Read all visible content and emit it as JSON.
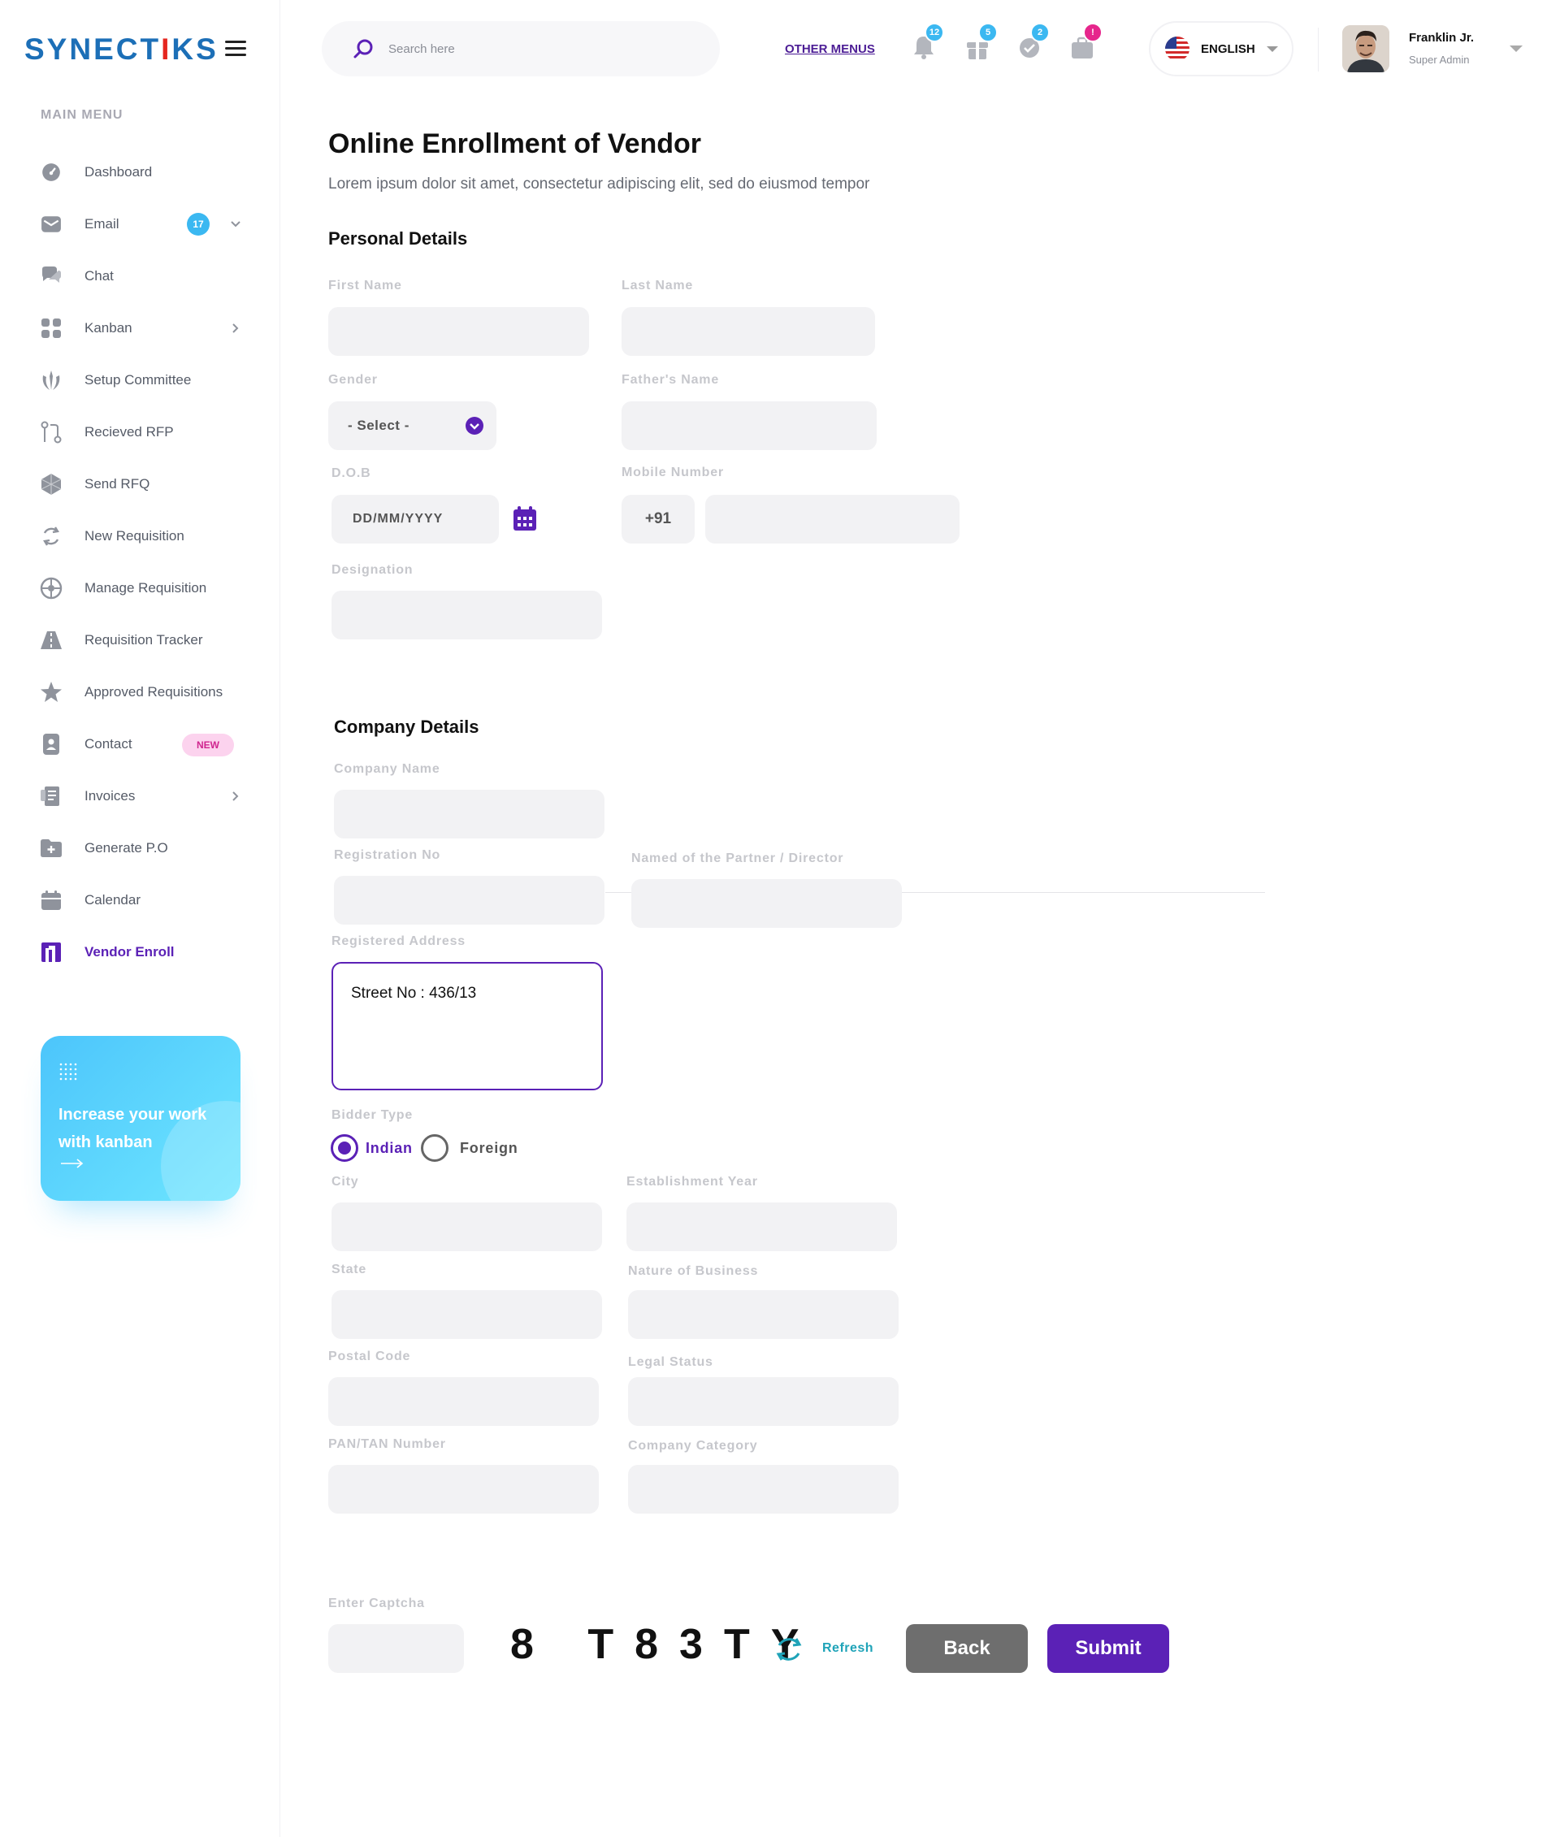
{
  "brand": {
    "logo_pre": "SYNECT",
    "logo_i": "I",
    "logo_post": "KS"
  },
  "sidebar": {
    "heading": "MAIN MENU",
    "items": [
      {
        "label": "Dashboard",
        "icon": "gauge-icon"
      },
      {
        "label": "Email",
        "icon": "mail-icon",
        "badge": "17"
      },
      {
        "label": "Chat",
        "icon": "chat-icon"
      },
      {
        "label": "Kanban",
        "icon": "grid-icon"
      },
      {
        "label": "Setup Committee",
        "icon": "committee-icon"
      },
      {
        "label": "Recieved RFP",
        "icon": "git-compare-icon"
      },
      {
        "label": "Send RFQ",
        "icon": "hexagon-icon"
      },
      {
        "label": "New Requisition",
        "icon": "refresh-icon"
      },
      {
        "label": "Manage Requisition",
        "icon": "aperture-icon"
      },
      {
        "label": "Requisition Tracker",
        "icon": "road-icon"
      },
      {
        "label": "Approved Requisitions",
        "icon": "star-icon"
      },
      {
        "label": "Contact",
        "icon": "contact-icon",
        "tag": "NEW"
      },
      {
        "label": "Invoices",
        "icon": "receipt-icon"
      },
      {
        "label": "Generate P.O",
        "icon": "folder-plus-icon"
      },
      {
        "label": "Calendar",
        "icon": "calendar-icon"
      },
      {
        "label": "Vendor Enroll",
        "icon": "vendor-icon"
      }
    ],
    "promo": {
      "text": "Increase your work with kanban"
    }
  },
  "header": {
    "search_placeholder": "Search here",
    "other_menus": "OTHER MENUS",
    "notifications": [
      {
        "icon": "bell-icon",
        "count": "12",
        "color": "#3bb8f1"
      },
      {
        "icon": "gift-icon",
        "count": "5",
        "color": "#3bb8f1"
      },
      {
        "icon": "chat-check-icon",
        "count": "2",
        "color": "#3bb8f1"
      },
      {
        "icon": "briefcase-icon",
        "count": "!",
        "color": "#e6268c"
      }
    ],
    "language": "ENGLISH",
    "user": {
      "name": "Franklin Jr.",
      "role": "Super Admin"
    }
  },
  "page": {
    "title": "Online Enrollment of Vendor",
    "subtitle": "Lorem ipsum dolor sit amet, consectetur adipiscing elit, sed do eiusmod tempor"
  },
  "personal": {
    "title": "Personal Details",
    "first_name": "First Name",
    "last_name": "Last Name",
    "gender": "Gender",
    "gender_value": "- Select -",
    "father_name": "Father's Name",
    "dob": "D.O.B",
    "dob_placeholder": "DD/MM/YYYY",
    "mobile": "Mobile Number",
    "mobile_code": "+91",
    "designation": "Designation"
  },
  "company": {
    "title": "Company Details",
    "company_name": "Company Name",
    "registration_no": "Registration No",
    "partner": "Named of the Partner / Director",
    "address": "Registered Address",
    "address_value": "Street No : 436/13",
    "bidder_type": "Bidder Type",
    "bidder_options": [
      "Indian",
      "Foreign"
    ],
    "bidder_selected": "Indian",
    "city": "City",
    "establishment_year": "Establishment Year",
    "state": "State",
    "nature_of_business": "Nature of Business",
    "postal_code": "Postal Code",
    "legal_status": "Legal Status",
    "pan_tan": "PAN/TAN Number",
    "company_category": "Company Category"
  },
  "captcha": {
    "label": "Enter Captcha",
    "code": "8 T83TY",
    "refresh": "Refresh"
  },
  "actions": {
    "back": "Back",
    "submit": "Submit"
  },
  "colors": {
    "accent": "#5b21b6",
    "brand_blue": "#1c6fb7",
    "badge_blue": "#3bb8f1",
    "badge_pink": "#e6268c",
    "refresh_teal": "#1fa3b8"
  }
}
